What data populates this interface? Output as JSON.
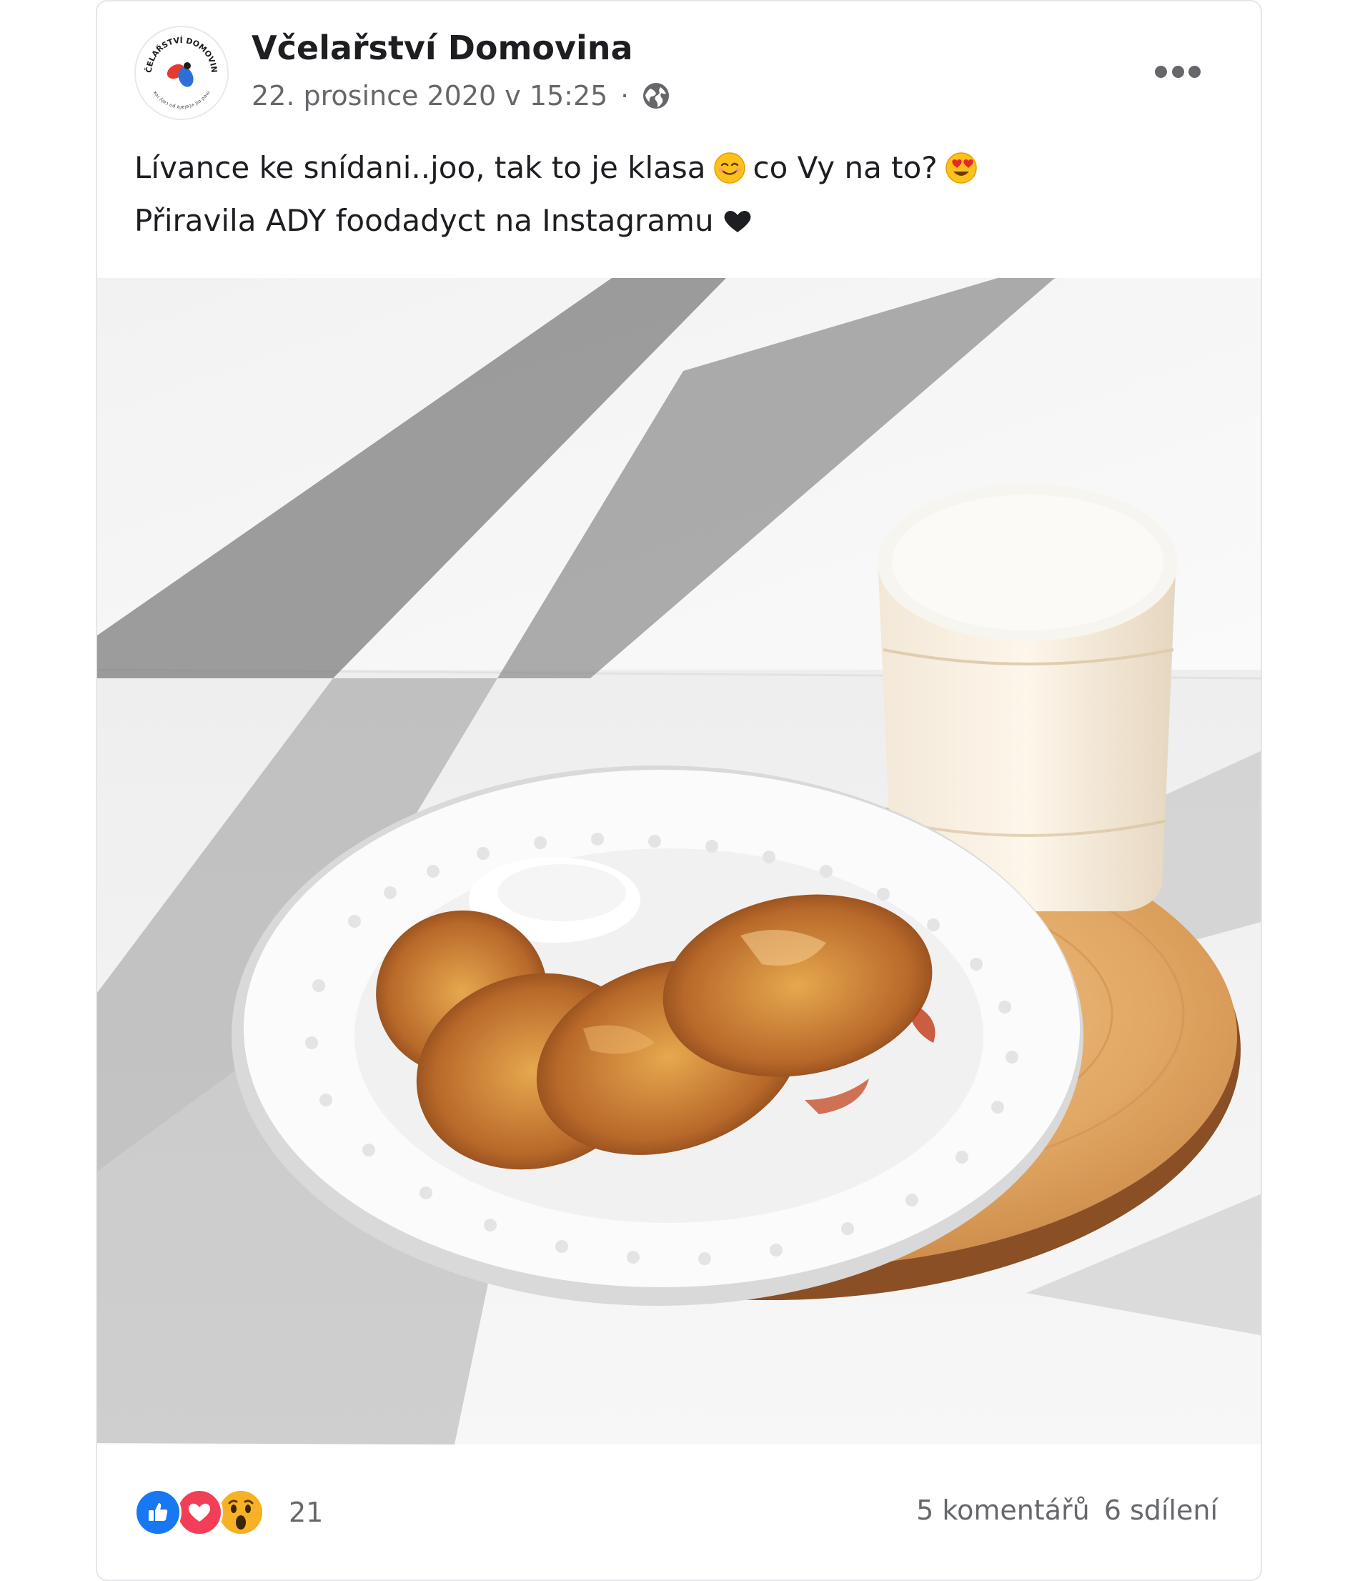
{
  "post": {
    "page_name": "Včelařství Domovina",
    "timestamp": "22. prosince 2020 v 15:25",
    "separator": "·",
    "privacy_icon": "globe-icon",
    "more_icon": "more-options-icon",
    "avatar": {
      "logo_text_top": "VČELAŘSTVÍ DOMOVINA",
      "logo_text_bottom": "med od včelaře po celý rok"
    },
    "text": {
      "line1_part1": "Lívance ke snídani..joo, tak to je klasa",
      "line1_emoji1": "smiling-face-emoji",
      "line1_part2": "co Vy na to?",
      "line1_emoji2": "heart-eyes-emoji",
      "line2_part1": "Přiravila ADY foodadyct na Instagramu",
      "line2_icon": "heart-icon"
    },
    "image": {
      "subject": "pancakes-with-caramel-and-milkshake"
    },
    "footer": {
      "reactions": [
        "like-reaction-icon",
        "love-reaction-icon",
        "wow-reaction-icon"
      ],
      "reaction_count": "21",
      "comments": "5 komentářů",
      "shares": "6 sdílení"
    }
  },
  "colors": {
    "text_primary": "#1c1e21",
    "text_secondary": "#65676b",
    "like_blue": "#1877f2",
    "love_red": "#f33e58",
    "wow_yellow": "#f7b125"
  }
}
